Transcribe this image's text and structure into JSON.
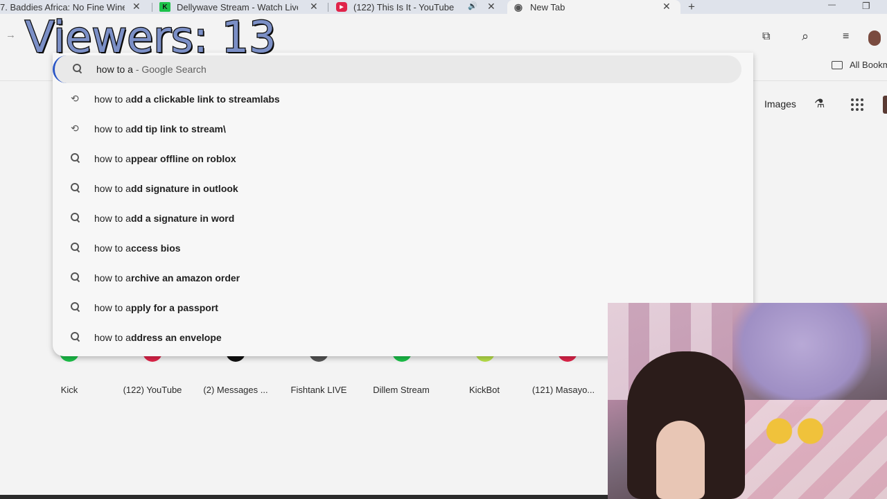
{
  "overlay": {
    "viewers": "Viewers: 13"
  },
  "tabs": [
    {
      "title": "7. Baddies Africa: No Fine Wine",
      "favicon": "none"
    },
    {
      "title": "Dellywave Stream - Watch Live",
      "favicon": "K"
    },
    {
      "title": "(122) This Is It - YouTube",
      "favicon": "▶",
      "audio_icon": "🔊"
    },
    {
      "title": "New Tab",
      "favicon": "◉"
    }
  ],
  "controls": {
    "new_tab": "+",
    "close": "✕",
    "minimize": "—",
    "restore": "❐",
    "forward": "→"
  },
  "toolbar_icons": {
    "extensions": "⧉",
    "tab_search": "⌕",
    "reading_list": "≡"
  },
  "bookmarks": {
    "all_bookmarks": "All Bookm"
  },
  "ntp_header": {
    "images": "Images",
    "lab": "⚗"
  },
  "omnibox": {
    "typed": "how to a",
    "suffix": " - Google Search"
  },
  "suggestions": [
    {
      "icon": "history",
      "prefix": "how to a",
      "bold": "dd a clickable link to streamlabs"
    },
    {
      "icon": "history",
      "prefix": "how to a",
      "bold": "dd tip link to stream\\"
    },
    {
      "icon": "search",
      "prefix": "how to a",
      "bold": "ppear offline on roblox"
    },
    {
      "icon": "search",
      "prefix": "how to a",
      "bold": "dd signature in outlook"
    },
    {
      "icon": "search",
      "prefix": "how to a",
      "bold": "dd a signature in word"
    },
    {
      "icon": "search",
      "prefix": "how to a",
      "bold": "ccess bios"
    },
    {
      "icon": "search",
      "prefix": "how to a",
      "bold": "rchive an amazon order"
    },
    {
      "icon": "search",
      "prefix": "how to a",
      "bold": "pply for a passport"
    },
    {
      "icon": "search",
      "prefix": "how to a",
      "bold": "ddress an envelope"
    }
  ],
  "shortcuts": [
    {
      "label": "Kick",
      "color": "#1cc24a"
    },
    {
      "label": "(122) YouTube",
      "color": "#e0244a"
    },
    {
      "label": "(2) Messages ...",
      "color": "#111111"
    },
    {
      "label": "Fishtank LIVE",
      "color": "#333333"
    },
    {
      "label": "Dillem Stream",
      "color": "#1cc24a"
    },
    {
      "label": "KickBot",
      "color": "#b8e04a"
    },
    {
      "label": "(121) Masayo...",
      "color": "#e0244a"
    }
  ]
}
